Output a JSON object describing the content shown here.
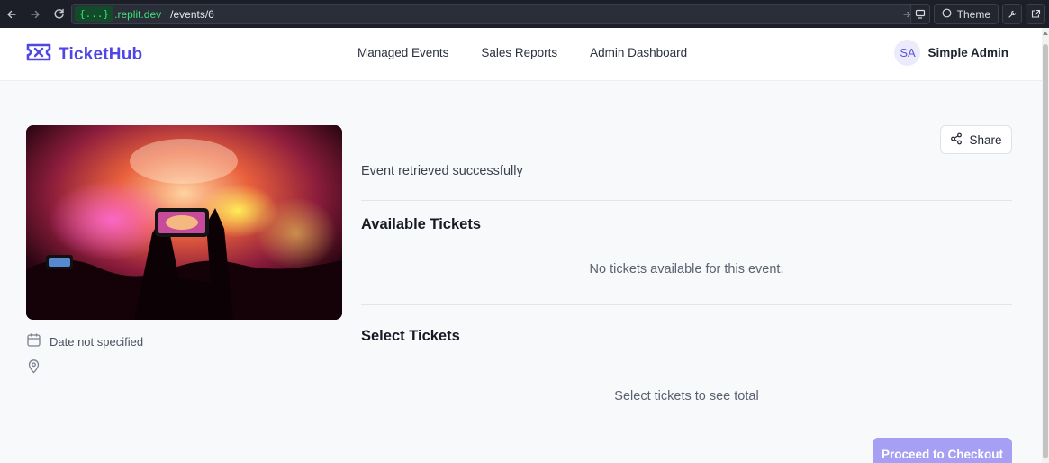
{
  "browser": {
    "url_badge": "{...}",
    "url_domain": ".replit.dev",
    "url_path": "/events/6",
    "theme_label": "Theme"
  },
  "header": {
    "logo_text": "TicketHub",
    "nav": [
      {
        "label": "Managed Events"
      },
      {
        "label": "Sales Reports"
      },
      {
        "label": "Admin Dashboard"
      }
    ],
    "user": {
      "initials": "SA",
      "name": "Simple Admin"
    }
  },
  "event": {
    "date": "Date not specified",
    "location": ""
  },
  "main": {
    "share_label": "Share",
    "status_message": "Event retrieved successfully",
    "available_title": "Available Tickets",
    "available_empty": "No tickets available for this event.",
    "select_title": "Select Tickets",
    "select_empty": "Select tickets to see total",
    "checkout_label": "Proceed to Checkout"
  },
  "colors": {
    "brand": "#4f46e5",
    "checkout_disabled": "#a5a0f3"
  }
}
